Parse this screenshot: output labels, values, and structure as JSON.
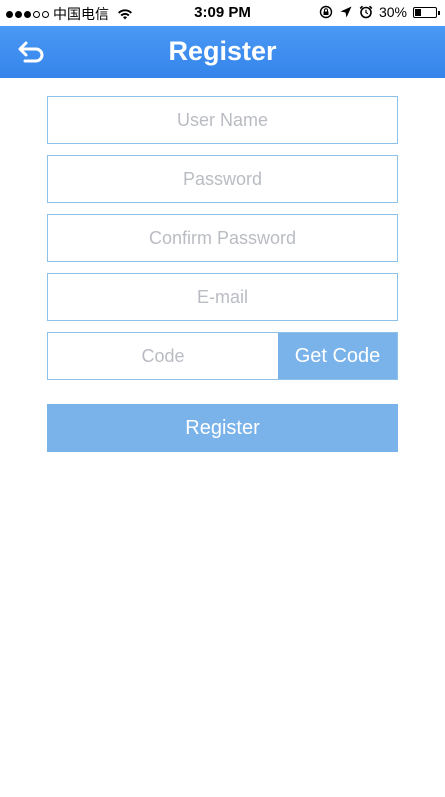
{
  "status_bar": {
    "carrier": "中国电信",
    "time": "3:09 PM",
    "battery_text": "30%",
    "battery_level": 0.3,
    "icons": [
      "signal-dots-icon",
      "wifi-icon",
      "rotation-lock-icon",
      "location-arrow-icon",
      "alarm-icon",
      "battery-icon"
    ]
  },
  "nav": {
    "title": "Register",
    "back_icon": "back-arrow-icon",
    "color": "#3b8ef0"
  },
  "form": {
    "username_placeholder": "User Name",
    "password_placeholder": "Password",
    "confirm_password_placeholder": "Confirm Password",
    "email_placeholder": "E-mail",
    "code_placeholder": "Code",
    "get_code_label": "Get Code",
    "register_label": "Register",
    "border_color": "#8ec1ea",
    "button_color": "#79b3ea"
  }
}
